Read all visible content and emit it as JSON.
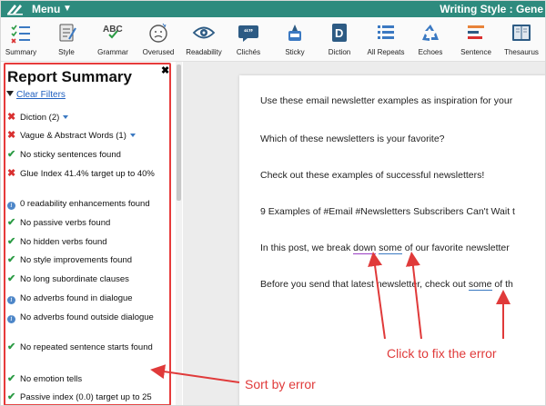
{
  "menu": {
    "label": "Menu",
    "writing_style": "Writing Style : Gene"
  },
  "toolbar": [
    {
      "key": "summary",
      "label": "Summary"
    },
    {
      "key": "style",
      "label": "Style"
    },
    {
      "key": "grammar",
      "label": "Grammar"
    },
    {
      "key": "overused",
      "label": "Overused"
    },
    {
      "key": "readability",
      "label": "Readability"
    },
    {
      "key": "cliches",
      "label": "Clichés"
    },
    {
      "key": "sticky",
      "label": "Sticky"
    },
    {
      "key": "diction",
      "label": "Diction"
    },
    {
      "key": "allrepeats",
      "label": "All Repeats"
    },
    {
      "key": "echoes",
      "label": "Echoes"
    },
    {
      "key": "sentence",
      "label": "Sentence"
    },
    {
      "key": "thesaurus",
      "label": "Thesaurus"
    }
  ],
  "report": {
    "title": "Report Summary",
    "clear_filters": "Clear Filters",
    "items": [
      {
        "status": "error",
        "text": "Diction (2)"
      },
      {
        "status": "error",
        "text": "Vague & Abstract Words (1)"
      },
      {
        "status": "ok",
        "text": "No sticky sentences found"
      },
      {
        "status": "error",
        "text": "Glue Index 41.4% target up to 40%"
      },
      {
        "status": "info",
        "text": "0 readability enhancements found"
      },
      {
        "status": "ok",
        "text": "No passive verbs found"
      },
      {
        "status": "ok",
        "text": "No hidden verbs found"
      },
      {
        "status": "ok",
        "text": "No style improvements found"
      },
      {
        "status": "ok",
        "text": "No long subordinate clauses"
      },
      {
        "status": "info",
        "text": "No adverbs found in dialogue"
      },
      {
        "status": "info",
        "text": "No adverbs found outside dialogue"
      },
      {
        "status": "ok",
        "text": "No repeated sentence starts found"
      },
      {
        "status": "ok",
        "text": "No emotion tells"
      },
      {
        "status": "ok",
        "text": "Passive index (0.0) target up to 25"
      }
    ]
  },
  "document": {
    "p1": "Use these email newsletter examples as inspiration for your",
    "p2": "Which of these newsletters is your favorite?",
    "p3": "Check out these examples of successful newsletters!",
    "p4": "9 Examples of #Email #Newsletters Subscribers Can't Wait t",
    "p5_a": "In this post, we break ",
    "p5_err1": "down",
    "p5_b": " ",
    "p5_err2": "some",
    "p5_c": " of our favorite newsletter",
    "p6_a": "Before you send that latest newsletter, check out ",
    "p6_err": "some",
    "p6_b": " of th"
  },
  "annotations": {
    "fix": "Click to fix the error",
    "sort": "Sort by error"
  },
  "colors": {
    "brand": "#2e8b7e",
    "annotation": "#e03a3a",
    "error": "#d93030",
    "ok": "#2b9b44",
    "info": "#3b79c2"
  }
}
